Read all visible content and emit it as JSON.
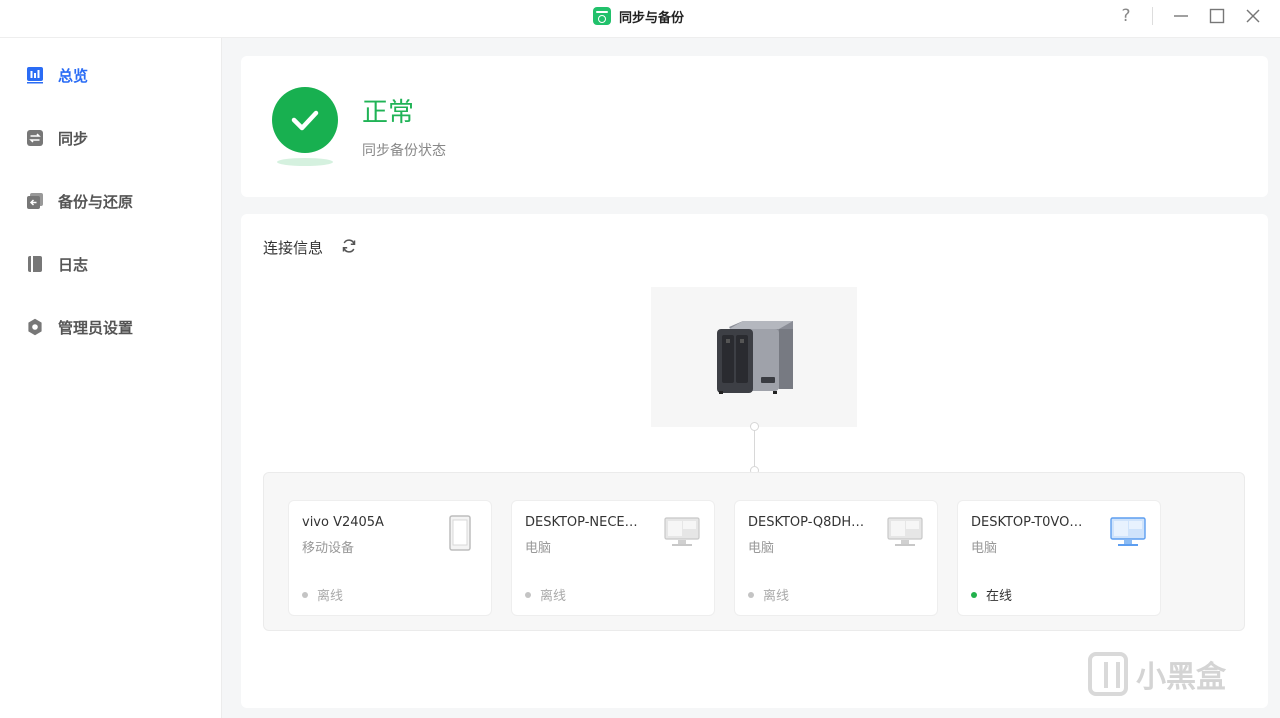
{
  "window": {
    "title": "同步与备份",
    "help": "?"
  },
  "sidebar": {
    "items": [
      {
        "label": "总览",
        "icon": "chart-icon",
        "active": true
      },
      {
        "label": "同步",
        "icon": "sync-icon",
        "active": false
      },
      {
        "label": "备份与还原",
        "icon": "backup-icon",
        "active": false
      },
      {
        "label": "日志",
        "icon": "log-icon",
        "active": false
      },
      {
        "label": "管理员设置",
        "icon": "gear-icon",
        "active": false
      }
    ]
  },
  "status": {
    "title": "正常",
    "subtitle": "同步备份状态"
  },
  "connection": {
    "title": "连接信息",
    "devices": [
      {
        "name": "vivo V2405A",
        "type": "移动设备",
        "status": "离线",
        "online": false,
        "icon": "phone-icon"
      },
      {
        "name": "DESKTOP-NECE…",
        "type": "电脑",
        "status": "离线",
        "online": false,
        "icon": "monitor-icon"
      },
      {
        "name": "DESKTOP-Q8DH…",
        "type": "电脑",
        "status": "离线",
        "online": false,
        "icon": "monitor-icon"
      },
      {
        "name": "DESKTOP-T0VO…",
        "type": "电脑",
        "status": "在线",
        "online": true,
        "icon": "monitor-icon"
      }
    ]
  },
  "watermark": {
    "text": "小黑盒"
  },
  "colors": {
    "accent": "#2a6cf5",
    "success": "#18b050",
    "offline_dot": "#c4c4c4",
    "online_dot": "#22b14c"
  }
}
